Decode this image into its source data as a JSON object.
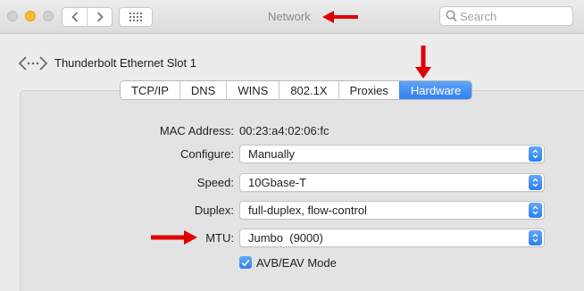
{
  "window": {
    "title": "Network"
  },
  "search": {
    "placeholder": "Search",
    "value": ""
  },
  "interface": {
    "name": "Thunderbolt Ethernet Slot 1",
    "icon": "ethernet-arrows-icon"
  },
  "tabs": [
    {
      "label": "TCP/IP",
      "active": false
    },
    {
      "label": "DNS",
      "active": false
    },
    {
      "label": "WINS",
      "active": false
    },
    {
      "label": "802.1X",
      "active": false
    },
    {
      "label": "Proxies",
      "active": false
    },
    {
      "label": "Hardware",
      "active": true
    }
  ],
  "form": {
    "mac_label": "MAC Address:",
    "mac_value": "00:23:a4:02:06:fc",
    "configure_label": "Configure:",
    "configure_value": "Manually",
    "speed_label": "Speed:",
    "speed_value": "10Gbase-T",
    "duplex_label": "Duplex:",
    "duplex_value": "full-duplex, flow-control",
    "mtu_label": "MTU:",
    "mtu_value": "Jumbo  (9000)",
    "avb_label": "AVB/EAV Mode",
    "avb_checked": true
  },
  "colors": {
    "accent": "#2f81ef",
    "annotation_arrow": "#e00000",
    "minimize_light": "#fcbc2e"
  }
}
